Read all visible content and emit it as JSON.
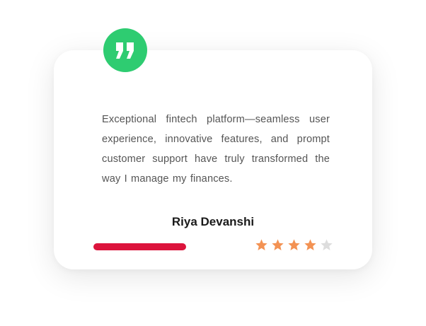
{
  "testimonial": {
    "quote_icon": "quote-icon",
    "text": "Exceptional fintech platform—seamless user experience, innovative features, and prompt customer support have truly transformed the way I manage my finances.",
    "author": "Riya Devanshi",
    "rating": 4,
    "rating_max": 5
  },
  "colors": {
    "badge": "#2ecc71",
    "accent_bar": "#dc143c",
    "star_filled": "#f39253",
    "star_empty": "#dddddd"
  }
}
